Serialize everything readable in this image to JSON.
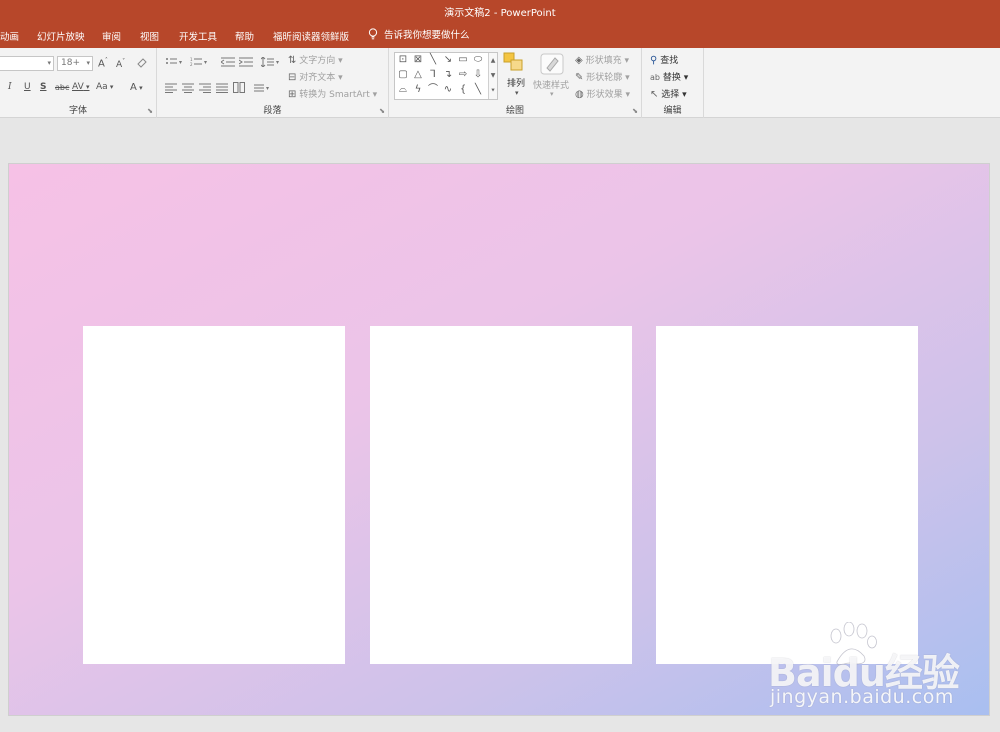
{
  "window": {
    "title": "演示文稿2  -  PowerPoint"
  },
  "tabs": [
    {
      "label": "动画"
    },
    {
      "label": "幻灯片放映"
    },
    {
      "label": "审阅"
    },
    {
      "label": "视图"
    },
    {
      "label": "开发工具"
    },
    {
      "label": "帮助"
    },
    {
      "label": "福昕阅读器领鲜版"
    }
  ],
  "tell_me": {
    "text": "告诉我你想要做什么",
    "icon": "lightbulb-icon"
  },
  "ribbon": {
    "font": {
      "label": "字体",
      "size_value": "18+",
      "grow_label": "A",
      "shrink_label": "A",
      "italic_label": "I",
      "underline_label": "U",
      "strike_label": "S",
      "abc_label": "abc",
      "spacing_label": "AV",
      "case_label": "Aa",
      "color_label": "A"
    },
    "paragraph": {
      "label": "段落",
      "text_direction": "文字方向",
      "align_text": "对齐文本",
      "convert_smartart": "转换为 SmartArt"
    },
    "drawing": {
      "label": "绘图",
      "arrange": "排列",
      "quick_styles": "快速样式",
      "shape_fill": "形状填充",
      "shape_outline": "形状轮廓",
      "shape_effects": "形状效果"
    },
    "editing": {
      "label": "编辑",
      "find": "查找",
      "replace": "替换",
      "select": "选择"
    }
  },
  "slide": {
    "cards": [
      {
        "name": "card-1"
      },
      {
        "name": "card-2"
      },
      {
        "name": "card-3"
      }
    ],
    "gradient_colors": [
      "#f6c1e6",
      "#cdc2ea",
      "#a9bff0"
    ]
  },
  "watermark": {
    "brand": "Baidu经验",
    "url": "jingyan.baidu.com"
  }
}
